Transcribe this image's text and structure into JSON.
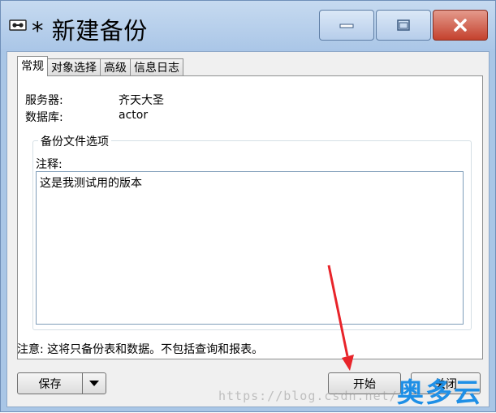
{
  "window": {
    "title": "* 新建备份",
    "icon": "tape-drive-icon",
    "controls": [
      "minimize-icon",
      "maximize-icon",
      "close-icon"
    ],
    "close_color": "#c4412d"
  },
  "tabs": [
    {
      "label": "常规",
      "active": true
    },
    {
      "label": "对象选择",
      "active": false
    },
    {
      "label": "高级",
      "active": false
    },
    {
      "label": "信息日志",
      "active": false
    }
  ],
  "general": {
    "server_label": "服务器:",
    "server_value": "齐天大圣",
    "database_label": "数据库:",
    "database_value": "actor",
    "group_title": "备份文件选项",
    "comment_label": "注释:",
    "comment_value": "这是我测试用的版本"
  },
  "note": "注意: 这将只备份表和数据。不包括查询和报表。",
  "buttons": {
    "save": "保存",
    "start": "开始",
    "close": "关闭"
  },
  "overlay": {
    "watermark": "https://blog.csdn.net/",
    "logo": "奥多云",
    "arrow_color": "#e8242a"
  }
}
